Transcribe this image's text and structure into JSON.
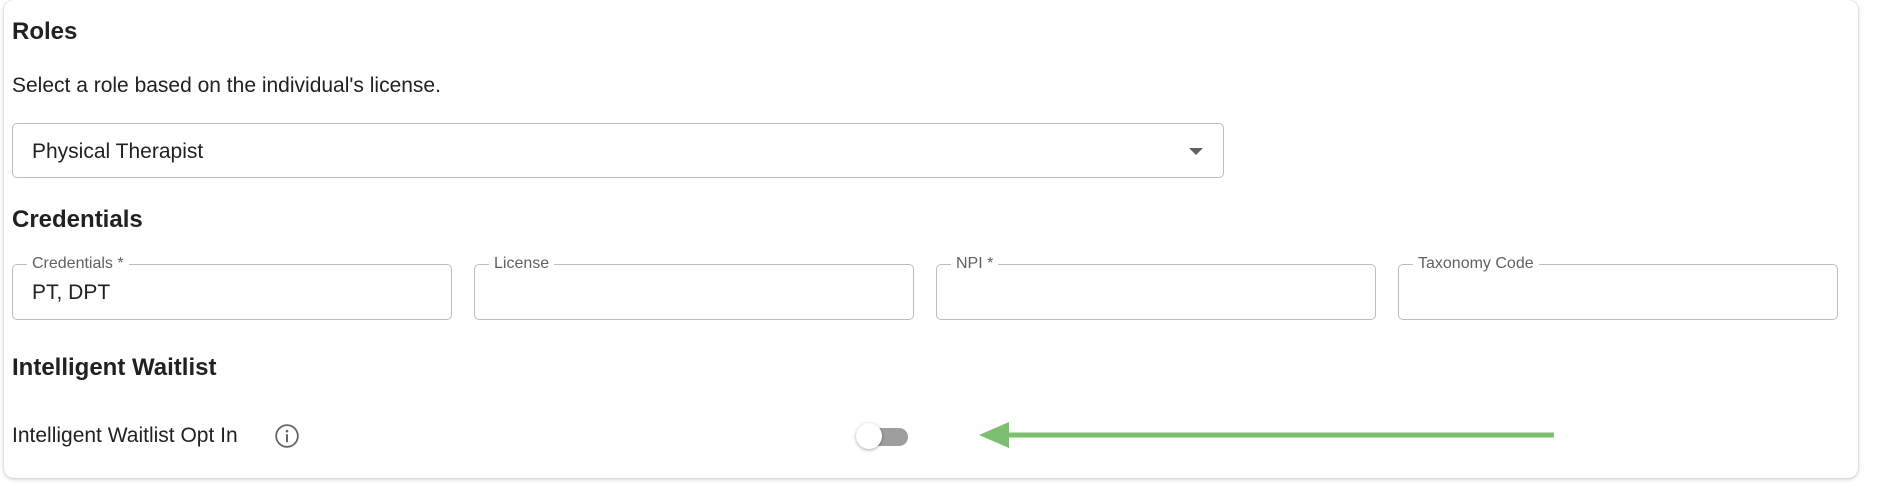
{
  "roles": {
    "heading": "Roles",
    "description": "Select a role based on the individual's license.",
    "selected_role": "Physical Therapist"
  },
  "credentials": {
    "heading": "Credentials",
    "fields": [
      {
        "label": "Credentials *",
        "value": "PT, DPT"
      },
      {
        "label": "License",
        "value": ""
      },
      {
        "label": "NPI *",
        "value": ""
      },
      {
        "label": "Taxonomy Code",
        "value": ""
      }
    ]
  },
  "waitlist": {
    "heading": "Intelligent Waitlist",
    "opt_in_label": "Intelligent Waitlist Opt In",
    "opt_in_enabled": false
  },
  "icons": {
    "info": "info-icon",
    "dropdown": "chevron-down-icon"
  },
  "colors": {
    "annotation_arrow": "#7cbf6e",
    "toggle_off_track": "#9e9e9e"
  }
}
